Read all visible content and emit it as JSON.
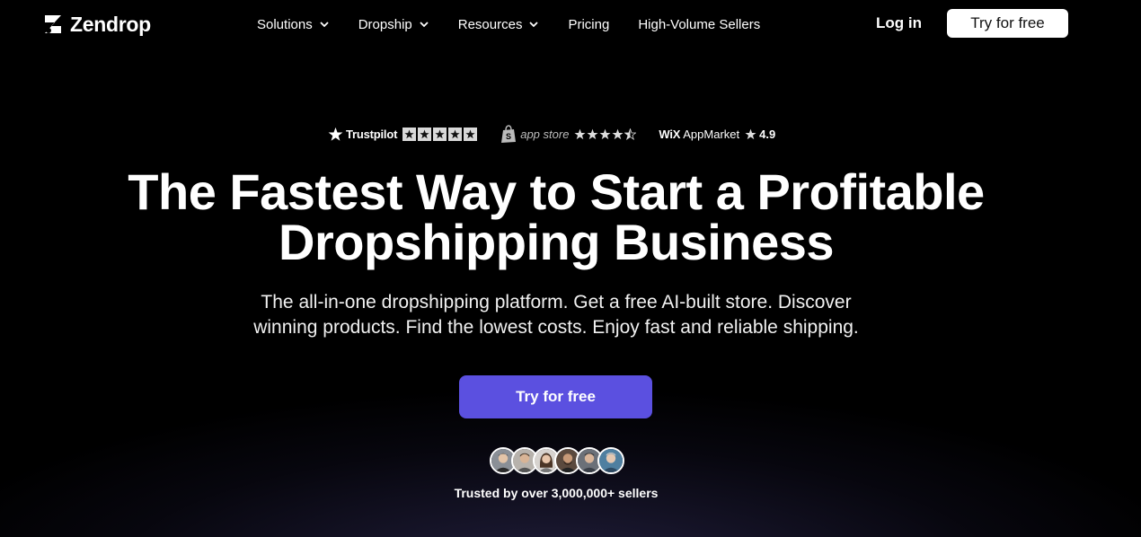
{
  "brand": {
    "name": "Zendrop"
  },
  "nav": {
    "items": [
      {
        "label": "Solutions",
        "has_menu": true
      },
      {
        "label": "Dropship",
        "has_menu": true
      },
      {
        "label": "Resources",
        "has_menu": true
      },
      {
        "label": "Pricing",
        "has_menu": false
      },
      {
        "label": "High-Volume Sellers",
        "has_menu": false
      }
    ],
    "login_label": "Log in",
    "cta_label": "Try for free"
  },
  "ratings": {
    "trustpilot": {
      "name": "Trustpilot",
      "stars": 5
    },
    "shopify": {
      "name": "app store",
      "stars": 4.5
    },
    "wix": {
      "brand": "WiX",
      "name": "AppMarket",
      "score": "4.9"
    }
  },
  "hero": {
    "headline_line1": "The Fastest Way to Start a Profitable",
    "headline_line2": "Dropshipping Business",
    "subtitle_line1": "The all-in-one dropshipping platform. Get a free AI-built store. Discover",
    "subtitle_line2": "winning products. Find the lowest costs. Enjoy fast and reliable shipping.",
    "cta_label": "Try for free",
    "trusted_text": "Trusted by over 3,000,000+ sellers"
  },
  "colors": {
    "background": "#000000",
    "cta": "#5b50e0",
    "text": "#ffffff"
  }
}
